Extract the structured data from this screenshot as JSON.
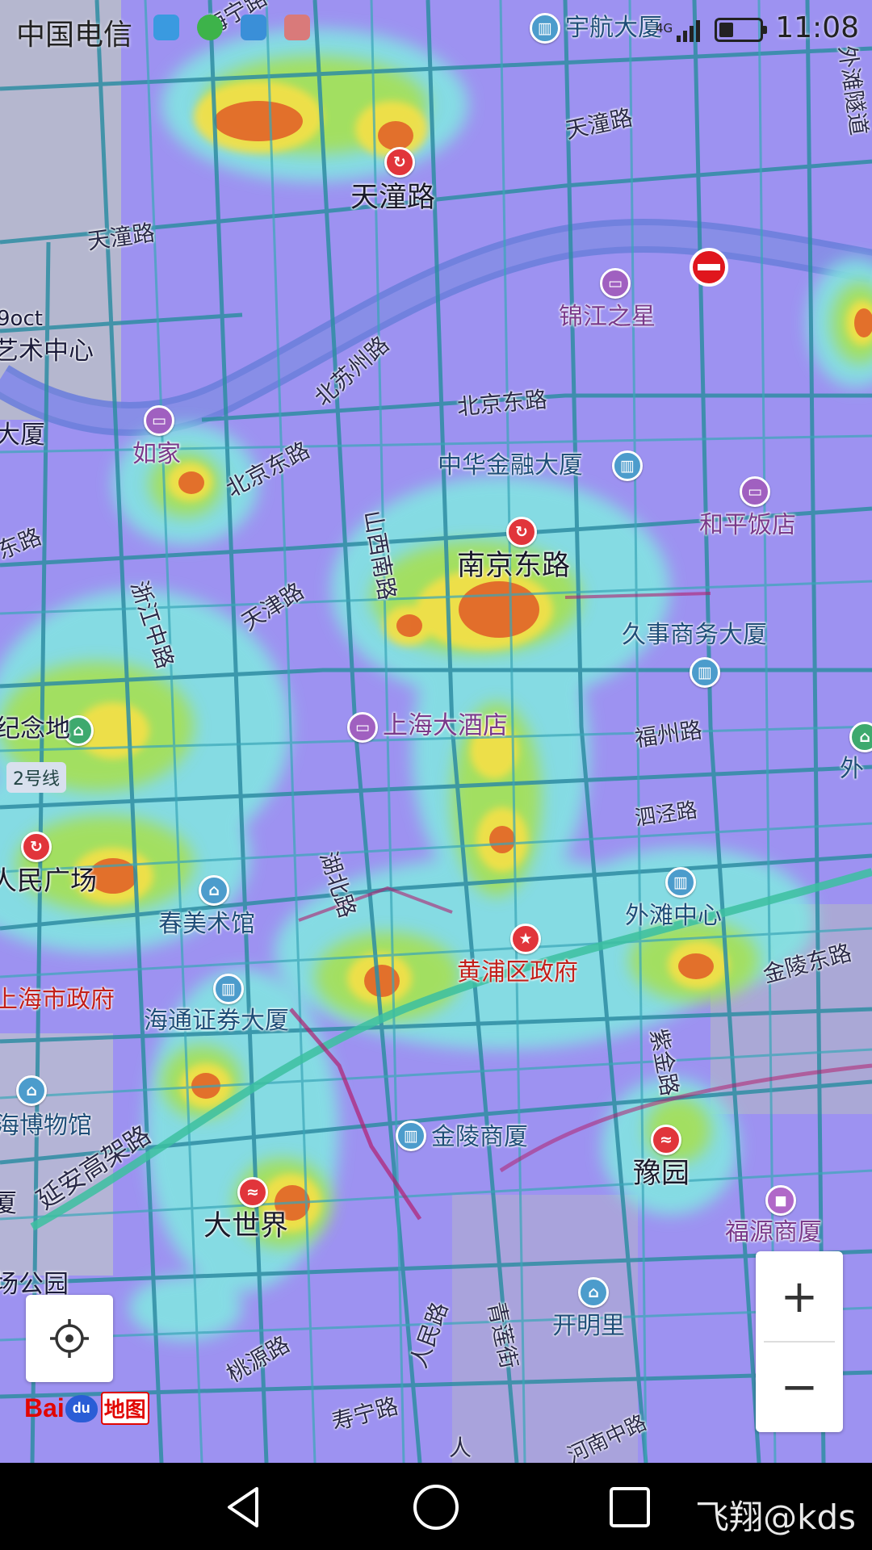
{
  "status_bar": {
    "carrier": "中国电信",
    "time": "11:08",
    "network": "4G",
    "battery_level": 0.35
  },
  "map": {
    "big_labels": [
      {
        "key": "tiantong",
        "text": "天潼路"
      },
      {
        "key": "nanjing_east",
        "text": "南京东路"
      },
      {
        "key": "dashijie",
        "text": "大世界"
      },
      {
        "key": "yuyuan",
        "text": "豫园"
      }
    ],
    "place_labels": {
      "shanghai_hotel": "上海大酒店",
      "jinjiang_star": "锦江之星",
      "rujia": "如家",
      "heping_hotel": "和平饭店",
      "zhonghua_finance": "中华金融大厦",
      "jiushi_bldg": "久事商务大厦",
      "yuhang_bldg": "宇航大厦",
      "waitan_center": "外滩中心",
      "chunmei_gallery": "春美术馆",
      "haitong_bldg": "海通证券大厦",
      "jinling_mall": "金陵商厦",
      "kaiming": "开明里",
      "fuyuan_mall": "福源商厦",
      "huangpu_gov": "黄浦区政府",
      "shanghai_gov": "上海市政府",
      "peoples_square": "人民广场",
      "museum": "海博物馆",
      "memorial": "纪念地",
      "art_center": "艺术中心",
      "oct": "9oct",
      "dasha_left": "大厦",
      "wai": "外",
      "xia": "厦",
      "park": "场公园",
      "line2": "2号线"
    },
    "road_labels": {
      "tiantong_road_top": "天潼路",
      "tiantong_road_left": "天潼路",
      "haining": "海宁路",
      "beisuzhou": "北苏州路",
      "beijing_east_1": "北京东路",
      "beijing_east_2": "北京东路",
      "shanxi_south": "山西南路",
      "zhejiang_mid": "浙江中路",
      "tianjin": "天津路",
      "fuzhou": "福州路",
      "sichuan": "泗泾路",
      "hubei": "湖北路",
      "jinling_east": "金陵东路",
      "zijin": "紫金路",
      "yanan_elevated": "延安高架路",
      "renmin": "人民路",
      "qinglian": "青莲街",
      "taoyuan": "桃源路",
      "shouning": "寿宁路",
      "donglu_left": "东路",
      "waitan_tunnel": "外滩隧道",
      "lower_road": "河南中路",
      "ren_bottom": "人"
    }
  },
  "controls": {
    "zoom_in": "+",
    "zoom_out": "−",
    "logo_bai": "Bai",
    "logo_du": "du",
    "logo_map": "地图"
  },
  "nav_bar": {
    "watermark": "飞翔@kds"
  },
  "colors": {
    "heat_low": "#7ee6e0",
    "heat_mid": "#a6e04a",
    "heat_high": "#f2e044",
    "heat_peak": "#e2692a",
    "base_violet": "#9a8ff0",
    "road": "#2f8fa0",
    "river": "#6e7fd8"
  }
}
